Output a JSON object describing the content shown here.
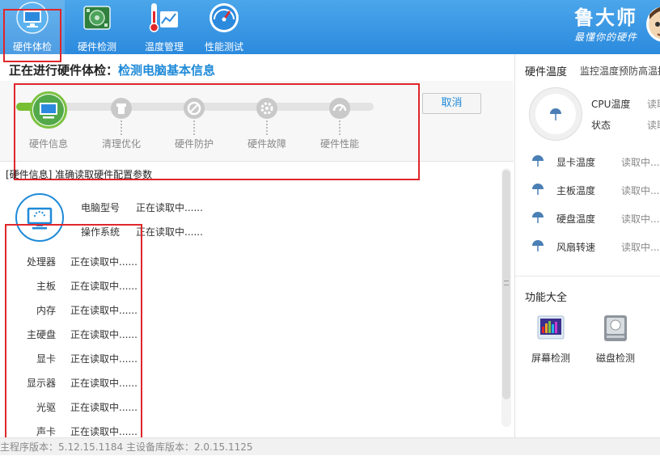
{
  "toolbar": {
    "items": [
      {
        "label": "硬件体检",
        "icon": "monitor-icon",
        "active": true
      },
      {
        "label": "硬件检测",
        "icon": "circuit-board-icon",
        "active": false
      },
      {
        "label": "温度管理",
        "icon": "thermometer-chart-icon",
        "active": false
      },
      {
        "label": "性能测试",
        "icon": "speedometer-icon",
        "active": false
      }
    ],
    "brand_name": "鲁大师",
    "brand_slogan": "最懂你的硬件"
  },
  "main": {
    "title_prefix": "正在进行硬件体检：",
    "title_highlight": "检测电脑基本信息",
    "cancel_label": "取消",
    "steps": [
      {
        "label": "硬件信息",
        "icon": "monitor-icon",
        "done": true
      },
      {
        "label": "清理优化",
        "icon": "broom-icon",
        "done": false
      },
      {
        "label": "硬件防护",
        "icon": "shield-icon",
        "done": false
      },
      {
        "label": "硬件故障",
        "icon": "gear-icon",
        "done": false
      },
      {
        "label": "硬件性能",
        "icon": "speedometer-icon",
        "done": false
      }
    ],
    "section_header": "[硬件信息] 准确读取硬件配置参数",
    "top_info": [
      {
        "key": "电脑型号",
        "value": "正在读取中......"
      },
      {
        "key": "操作系统",
        "value": "正在读取中......"
      }
    ],
    "hardware_list": [
      {
        "key": "处理器",
        "value": "正在读取中......"
      },
      {
        "key": "主板",
        "value": "正在读取中......"
      },
      {
        "key": "内存",
        "value": "正在读取中......"
      },
      {
        "key": "主硬盘",
        "value": "正在读取中......"
      },
      {
        "key": "显卡",
        "value": "正在读取中......"
      },
      {
        "key": "显示器",
        "value": "正在读取中......"
      },
      {
        "key": "光驱",
        "value": "正在读取中......"
      },
      {
        "key": "声卡",
        "value": "正在读取中......"
      }
    ]
  },
  "status_bar": {
    "text": "主程序版本：5.12.15.1184  主设备库版本：2.0.15.1125"
  },
  "right_panel": {
    "title": "硬件温度",
    "subtitle": "监控温度预防高温损",
    "cpu_temp_label": "CPU温度",
    "cpu_temp_value": "读取",
    "state_label": "状态",
    "state_value": "读取",
    "temps": [
      {
        "label": "显卡温度",
        "value": "读取中..."
      },
      {
        "label": "主板温度",
        "value": "读取中..."
      },
      {
        "label": "硬盘温度",
        "value": "读取中..."
      },
      {
        "label": "风扇转速",
        "value": "读取中..."
      }
    ],
    "features_title": "功能大全",
    "features": [
      {
        "label": "屏幕检测",
        "icon": "screen-test-icon"
      },
      {
        "label": "磁盘检测",
        "icon": "disk-check-icon"
      }
    ]
  }
}
